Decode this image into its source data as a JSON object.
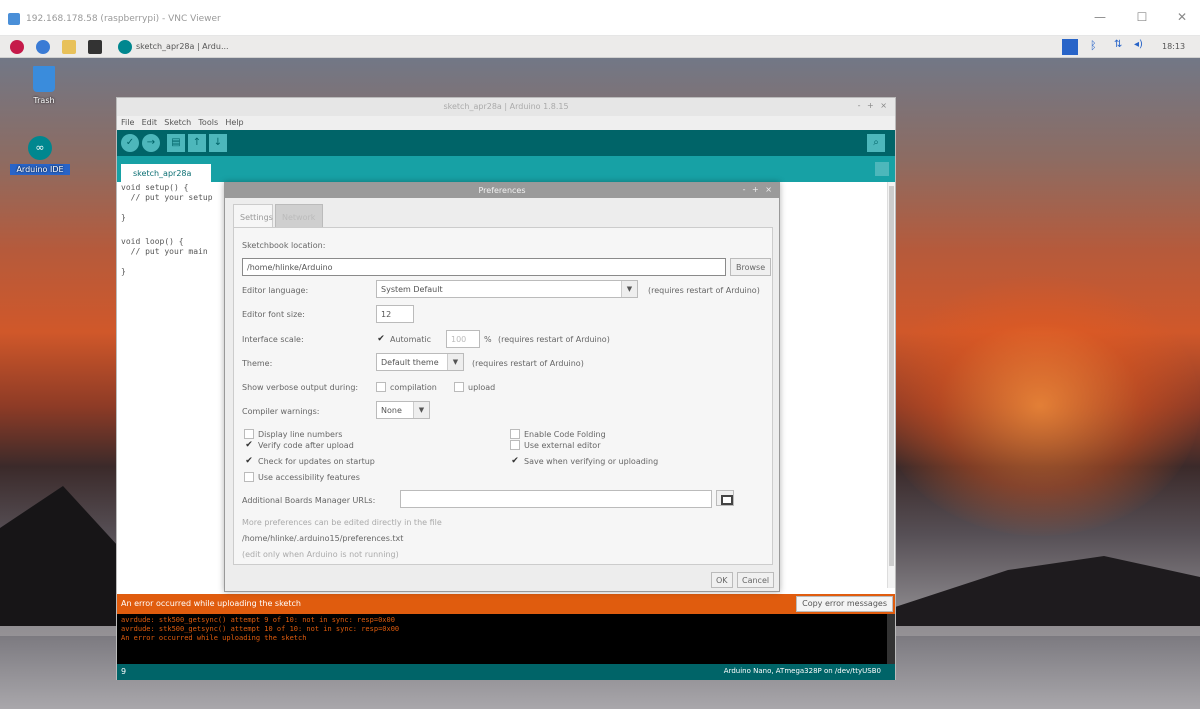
{
  "vnc": {
    "title": "192.168.178.58 (raspberrypi) - VNC Viewer",
    "controls": {
      "minimize": "—",
      "maximize": "☐",
      "close": "✕"
    }
  },
  "taskbar": {
    "task_label": "sketch_apr28a | Ardu...",
    "clock": "18:13"
  },
  "desktop": {
    "trash_label": "Trash",
    "arduino_label": "Arduino IDE",
    "arduino_glyph": "∞"
  },
  "ide": {
    "title": "sketch_apr28a | Arduino 1.8.15",
    "window_controls": "- + ×",
    "menu": [
      "File",
      "Edit",
      "Sketch",
      "Tools",
      "Help"
    ],
    "toolbar": {
      "verify": "✓",
      "upload": "→",
      "new": "▤",
      "open": "↑",
      "save": "↓",
      "serial_monitor": "⌕"
    },
    "tab_label": "sketch_apr28a",
    "tab_menu": "▾",
    "code": [
      "void setup() {",
      "  // put your setup",
      "",
      "}",
      "",
      "void loop() {",
      "  // put your main",
      "",
      "}"
    ],
    "status_message": "An error occurred while uploading the sketch",
    "copy_button": "Copy error messages",
    "console": [
      "avrdude: stk500_getsync() attempt 9 of 10: not in sync: resp=0x00",
      "avrdude: stk500_getsync() attempt 10 of 10: not in sync: resp=0x00",
      "An error occurred while uploading the sketch"
    ],
    "footer_line": "9",
    "footer_board": "Arduino Nano, ATmega328P on /dev/ttyUSB0"
  },
  "prefs": {
    "title": "Preferences",
    "window_controls": "- + ×",
    "tabs": {
      "settings": "Settings",
      "network": "Network"
    },
    "sketchbook_label": "Sketchbook location:",
    "sketchbook_value": "/home/hlinke/Arduino",
    "browse": "Browse",
    "editor_language_label": "Editor language:",
    "editor_language_value": "System Default",
    "editor_language_note": "(requires restart of Arduino)",
    "font_size_label": "Editor font size:",
    "font_size_value": "12",
    "scale_label": "Interface scale:",
    "scale_automatic": "Automatic",
    "scale_value": "100",
    "scale_percent": "%",
    "scale_note": "(requires restart of Arduino)",
    "theme_label": "Theme:",
    "theme_value": "Default theme",
    "theme_note": "(requires restart of Arduino)",
    "verbose_label": "Show verbose output during:",
    "verbose_compilation": "compilation",
    "verbose_upload": "upload",
    "warnings_label": "Compiler warnings:",
    "warnings_value": "None",
    "checks_left": [
      {
        "label": "Display line numbers",
        "checked": false
      },
      {
        "label": "Verify code after upload",
        "checked": true
      },
      {
        "label": "Check for updates on startup",
        "checked": true
      },
      {
        "label": "Use accessibility features",
        "checked": false
      }
    ],
    "checks_right": [
      {
        "label": "Enable Code Folding",
        "checked": false
      },
      {
        "label": "Use external editor",
        "checked": false
      },
      {
        "label": "Save when verifying or uploading",
        "checked": true
      }
    ],
    "boards_url_label": "Additional Boards Manager URLs:",
    "boards_url_value": "",
    "more_prefs_note": "More preferences can be edited directly in the file",
    "prefs_path": "/home/hlinke/.arduino15/preferences.txt",
    "edit_note": "(edit only when Arduino is not running)",
    "ok": "OK",
    "cancel": "Cancel"
  },
  "colors": {
    "arduino_teal_dark": "#006468",
    "arduino_teal": "#17a1a5",
    "error_orange": "#e05c0e"
  }
}
